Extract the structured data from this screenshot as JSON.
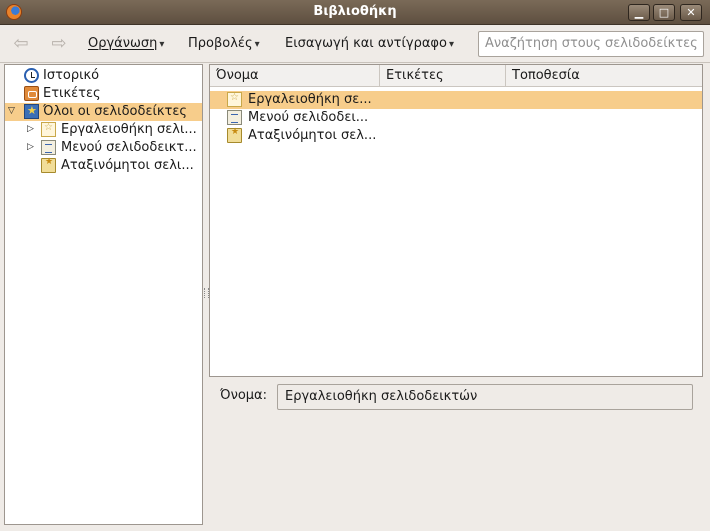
{
  "window": {
    "title": "Βιβλιοθήκη",
    "minimize_glyph": "▁",
    "maximize_glyph": "□",
    "close_glyph": "✕"
  },
  "toolbar": {
    "back_glyph": "⇦",
    "forward_glyph": "⇨",
    "organize_label": "Οργάνωση",
    "views_label": "Προβολές",
    "import_label": "Εισαγωγή και αντίγραφο",
    "chevron": "▾",
    "search_placeholder": "Αναζήτηση στους σελιδοδείκτες"
  },
  "sidebar": {
    "items": [
      {
        "label": "Ιστορικό",
        "icon": "clock-icon"
      },
      {
        "label": "Ετικέτες",
        "icon": "tag-icon"
      },
      {
        "label": "Όλοι οι σελιδοδείκτες",
        "icon": "folder-star-icon",
        "expanded": true,
        "selected": true
      },
      {
        "label": "Εργαλειοθήκη σελι...",
        "icon": "toolbar-folder-icon",
        "expandable": true
      },
      {
        "label": "Μενού σελιδοδεικτ...",
        "icon": "menu-folder-icon",
        "expandable": true
      },
      {
        "label": "Αταξινόμητοι σελι...",
        "icon": "unsorted-icon"
      }
    ],
    "expanded_glyph": "▽",
    "collapsed_glyph": "▷"
  },
  "list": {
    "columns": [
      "Όνομα",
      "Ετικέτες",
      "Τοποθεσία"
    ],
    "rows": [
      {
        "name": "Εργαλειοθήκη σε...",
        "icon": "toolbar-folder-icon",
        "selected": true
      },
      {
        "name": "Μενού σελιδοδει...",
        "icon": "menu-folder-icon"
      },
      {
        "name": "Αταξινόμητοι σελ...",
        "icon": "unsorted-icon"
      }
    ]
  },
  "details": {
    "name_label": "Όνομα:",
    "name_value": "Εργαλειοθήκη σελιδοδεικτών"
  }
}
